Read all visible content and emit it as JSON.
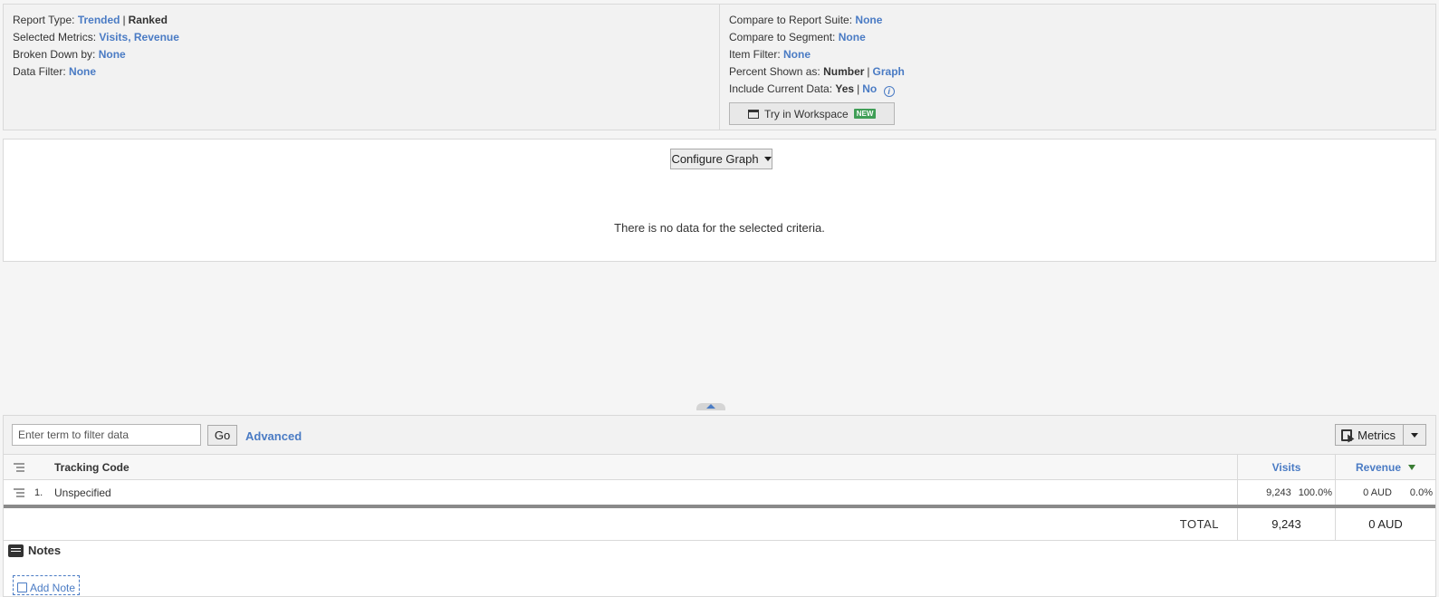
{
  "settings": {
    "report_type_label": "Report Type:",
    "report_type_trended": "Trended",
    "report_type_ranked": "Ranked",
    "selected_metrics_label": "Selected Metrics:",
    "metric_visits": "Visits",
    "metric_revenue": "Revenue",
    "broken_down_label": "Broken Down by:",
    "broken_down_value": "None",
    "data_filter_label": "Data Filter:",
    "data_filter_value": "None",
    "compare_suite_label": "Compare to Report Suite:",
    "compare_suite_value": "None",
    "compare_segment_label": "Compare to Segment:",
    "compare_segment_value": "None",
    "item_filter_label": "Item Filter:",
    "item_filter_value": "None",
    "percent_label": "Percent Shown as:",
    "percent_number": "Number",
    "percent_graph": "Graph",
    "current_data_label": "Include Current Data:",
    "current_data_yes": "Yes",
    "current_data_no": "No",
    "workspace_button": "Try in Workspace",
    "new_badge": "NEW"
  },
  "graph": {
    "configure_button": "Configure Graph",
    "empty_message": "There is no data for the selected criteria."
  },
  "toolbar": {
    "filter_placeholder": "Enter term to filter data",
    "go_button": "Go",
    "advanced_link": "Advanced",
    "metrics_button": "Metrics"
  },
  "table": {
    "dimension_header": "Tracking Code",
    "col_visits": "Visits",
    "col_revenue": "Revenue",
    "rows": [
      {
        "index": "1.",
        "name": "Unspecified",
        "visits": "9,243",
        "visits_pct": "100.0%",
        "revenue": "0 AUD",
        "revenue_pct": "0.0%"
      }
    ],
    "total_label": "TOTAL",
    "total_visits": "9,243",
    "total_revenue": "0 AUD"
  },
  "notes": {
    "title": "Notes",
    "add_note": "Add Note"
  },
  "colors": {
    "link": "#4a7bc4",
    "new_badge": "#3f9e56",
    "sort_arrow": "#3a7d34"
  }
}
